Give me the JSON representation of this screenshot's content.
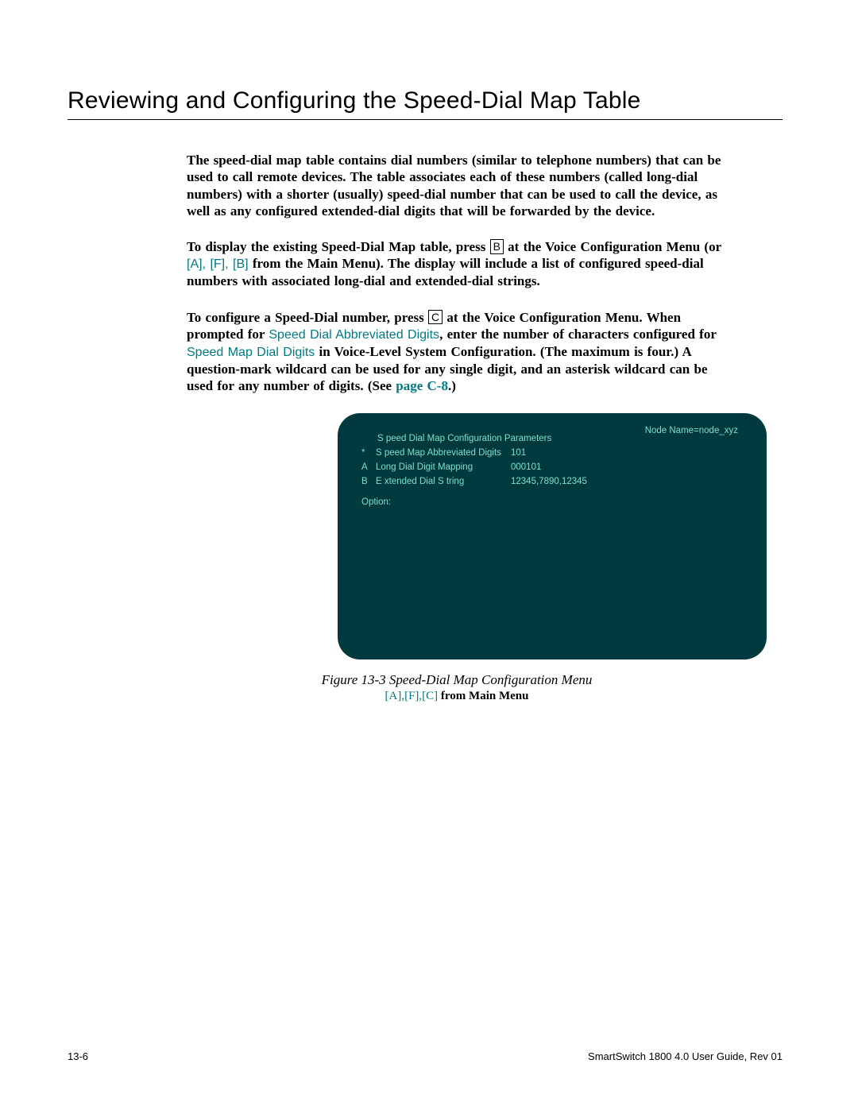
{
  "title": "Reviewing and Configuring the Speed-Dial Map Table",
  "para1": {
    "text": "The speed-dial map table contains dial numbers (similar to telephone numbers) that can be used to call remote devices. The table associates each of these numbers (called long-dial numbers) with a shorter (usually) speed-dial number that can be used to call the device, as well as any configured extended-dial digits that will be forwarded by the device."
  },
  "para2": {
    "a": "To display the existing Speed-Dial Map table, press ",
    "key": "B",
    "b": " at the Voice Configuration Menu (or ",
    "seq": "[A], [F], [B]",
    "c": " from the Main Menu). The display will include a list of configured speed-dial numbers with associated long-dial and extended-dial strings."
  },
  "para3": {
    "a": "To configure a Speed-Dial number, press ",
    "key": "C",
    "b": " at the Voice Configuration Menu. When prompted for ",
    "field1": "Speed Dial Abbreviated Digits",
    "c": ", enter the number of characters configured for ",
    "field2": "Speed Map Dial Digits",
    "d": " in Voice-Level System Configuration. (The maximum is four.) A question-mark wildcard can be used for any single digit, and an asterisk wildcard can be used for any number of digits. (See ",
    "pageref": "page C-8",
    "e": ".)"
  },
  "terminal": {
    "nodeName": "Node Name=node_xyz",
    "heading": "S peed Dial Map Configuration Parameters",
    "rows": [
      {
        "key": "*",
        "label": "S peed Map Abbreviated Digits",
        "value": "101"
      },
      {
        "key": "A",
        "label": "Long Dial Digit Mapping",
        "value": "000101"
      },
      {
        "key": "B",
        "label": "E xtended Dial S tring",
        "value": "12345,7890,12345"
      }
    ],
    "option": "Option:"
  },
  "figure": {
    "caption": "Figure 13-3    Speed-Dial Map Configuration Menu",
    "subseq": "[A],[F],[C]",
    "subtail": " from Main Menu"
  },
  "footer": {
    "left": "13-6",
    "right": "SmartSwitch 1800 4.0 User Guide, Rev 01"
  }
}
